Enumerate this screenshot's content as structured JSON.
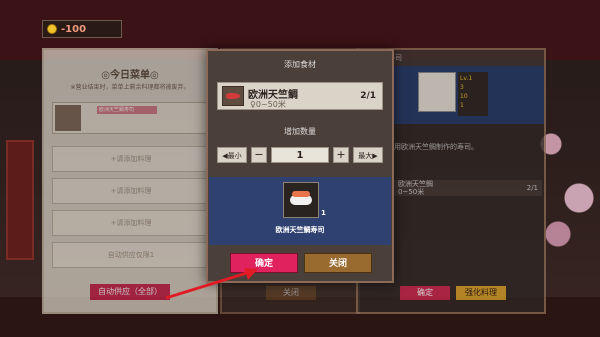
{
  "hud": {
    "coin_text": "-100",
    "icon": "coin-icon"
  },
  "left_menu": {
    "title": "◎今日菜单◎",
    "subtitle": "※营业结束时，菜单上剩余料理都将被废弃。",
    "dish_name": "欧洲天竺鲷寿司",
    "rows": [
      "+请添加料理",
      "+请添加料理",
      "+请添加料理",
      "自动供应仅限1"
    ],
    "auto_supply": "自动供应（全部）"
  },
  "middle": {
    "close_label": "关闭"
  },
  "right_panel": {
    "header": "寿司",
    "stats": [
      "Lv.1",
      "3",
      "10",
      "1"
    ],
    "description": "用欧洲天竺鲷制作的寿司。",
    "ingredient": {
      "name": "欧洲天竺鲷",
      "sub": "0~50米",
      "count": "2/1"
    },
    "confirm_label": "确定",
    "strengthen_label": "强化料理"
  },
  "modal": {
    "title": "添加食材",
    "ingredient": {
      "name": "欧洲天竺鲷",
      "range": "♀0~50米",
      "count": "2/1",
      "icon": "fish-icon"
    },
    "quantity_label": "增加数量",
    "min_label": "◀最小",
    "minus_label": "−",
    "quantity": "1",
    "plus_label": "+",
    "max_label": "最大▶",
    "result": {
      "name": "欧洲天竺鲷寿司",
      "count": "1",
      "icon": "sushi-icon"
    },
    "confirm_label": "确定",
    "close_label": "关闭"
  },
  "colors": {
    "confirm": "#e0225e",
    "close": "#9a6b2f",
    "arrow": "#e01b24",
    "result_bg": "#2f4170"
  }
}
